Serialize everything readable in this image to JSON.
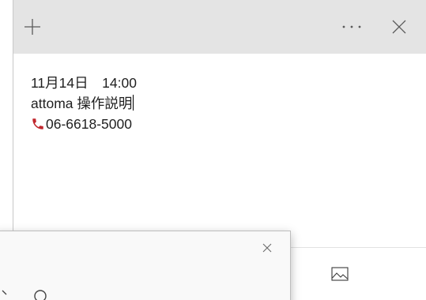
{
  "note": {
    "lines": {
      "datetime": "11月14日　14:00",
      "title": "attoma 操作説明",
      "phone": "06-6618-5000"
    }
  },
  "icons": {
    "add": "plus-icon",
    "more": "more-horizontal-icon",
    "close": "close-icon",
    "phone": "telephone-icon",
    "image": "image-icon",
    "popup_close": "close-icon"
  },
  "colors": {
    "titlebar": "#e4e4e4",
    "phone_icon": "#c0262d",
    "popup_background": "#f9f9f9"
  }
}
